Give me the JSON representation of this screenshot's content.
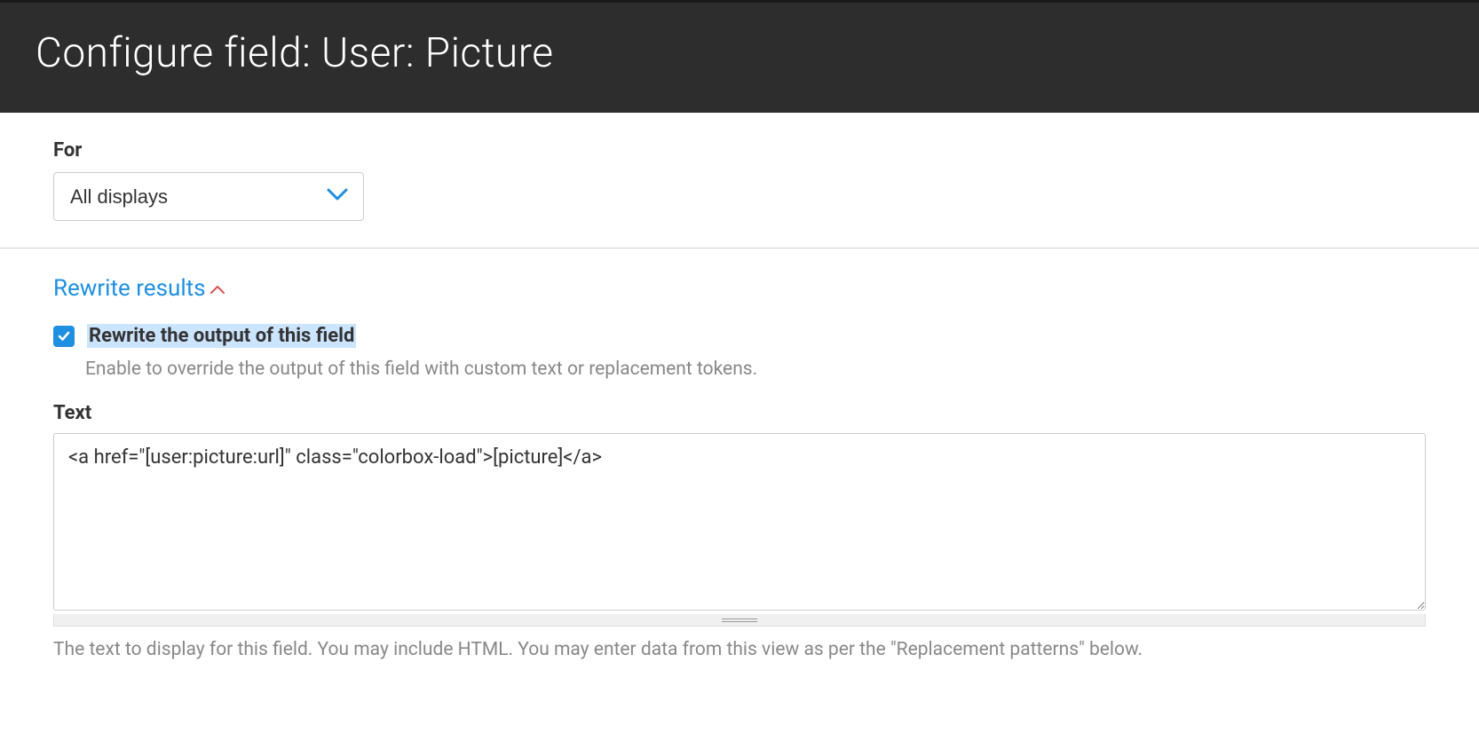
{
  "header": {
    "title": "Configure field: User: Picture"
  },
  "for": {
    "label": "For",
    "selected": "All displays"
  },
  "rewrite": {
    "header": "Rewrite results",
    "checkbox_label": "Rewrite the output of this field",
    "description": "Enable to override the output of this field with custom text or replacement tokens.",
    "text_label": "Text",
    "text_value": "<a href=\"[user:picture:url]\" class=\"colorbox-load\">[picture]</a>",
    "help_text": "The text to display for this field. You may include HTML. You may enter data from this view as per the \"Replacement patterns\" below."
  }
}
